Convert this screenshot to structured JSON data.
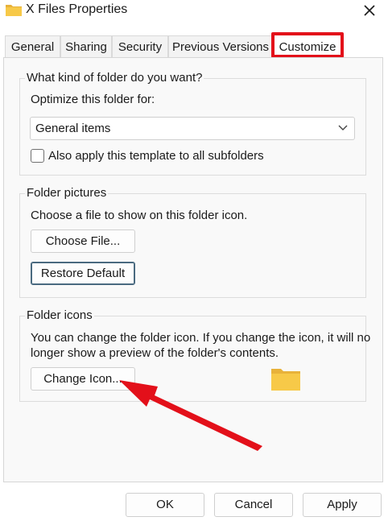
{
  "window": {
    "title": "X Files Properties"
  },
  "tabs": [
    {
      "label": "General"
    },
    {
      "label": "Sharing"
    },
    {
      "label": "Security"
    },
    {
      "label": "Previous Versions"
    },
    {
      "label": "Customize"
    }
  ],
  "folder_type": {
    "group_label": "What kind of folder do you want?",
    "optimize_label": "Optimize this folder for:",
    "selected": "General items",
    "checkbox_label": "Also apply this template to all subfolders",
    "checkbox_checked": false
  },
  "folder_pictures": {
    "group_label": "Folder pictures",
    "description": "Choose a file to show on this folder icon.",
    "choose_file_button": "Choose File...",
    "restore_default_button": "Restore Default"
  },
  "folder_icons": {
    "group_label": "Folder icons",
    "description_line1": "You can change the folder icon. If you change the icon, it will no",
    "description_line2": "longer show a preview of the folder's contents.",
    "change_icon_button": "Change Icon..."
  },
  "footer": {
    "ok": "OK",
    "cancel": "Cancel",
    "apply": "Apply"
  },
  "colors": {
    "highlight": "#e3101a",
    "folder": "#f7c948"
  }
}
